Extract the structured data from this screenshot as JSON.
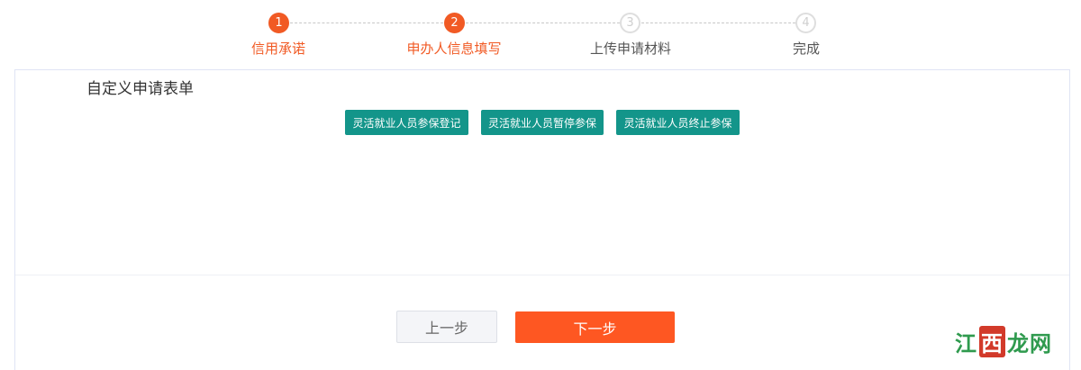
{
  "stepper": {
    "steps": [
      {
        "number": "1",
        "label": "信用承诺",
        "state": "active"
      },
      {
        "number": "2",
        "label": "申办人信息填写",
        "state": "active"
      },
      {
        "number": "3",
        "label": "上传申请材料",
        "state": "inactive"
      },
      {
        "number": "4",
        "label": "完成",
        "state": "inactive"
      }
    ]
  },
  "panel": {
    "title": "自定义申请表单",
    "form_buttons": [
      "灵活就业人员参保登记",
      "灵活就业人员暂停参保",
      "灵活就业人员终止参保"
    ],
    "prev_label": "上一步",
    "next_label": "下一步"
  },
  "watermark": {
    "part1": "江",
    "part2": "西",
    "part3": "龙网"
  },
  "colors": {
    "accent": "#f15a24",
    "next_button": "#fe5722",
    "form_button": "#13958a",
    "inactive_step": "#dedede"
  }
}
